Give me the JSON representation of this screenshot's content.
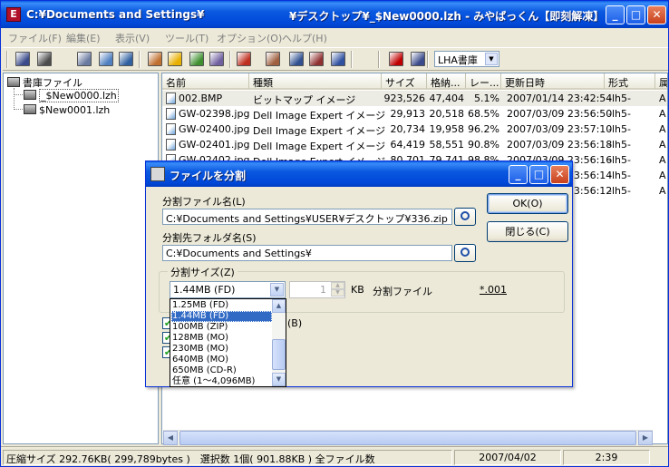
{
  "window": {
    "app_icon": "E",
    "title": "C:¥Documents and Settings¥",
    "title_right": "¥デスクトップ¥_$New0000.lzh - みやばっくん【即刻解凍】",
    "minimize": "_",
    "maximize": "□",
    "close": "✕"
  },
  "menu": [
    {
      "label": "ファイル(F)"
    },
    {
      "label": "編集(E)"
    },
    {
      "label": "表示(V)"
    },
    {
      "label": "ツール(T)"
    },
    {
      "label": "オプション(O)"
    },
    {
      "label": "ヘルプ(H)"
    }
  ],
  "toolbar": {
    "archive_type": "LHA書庫",
    "colors": [
      "#3a4a8a",
      "#4c4c4c",
      "#6a7aa0",
      "#5080c0",
      "#3060a0",
      "#c07030",
      "#e8b000",
      "#409030",
      "#7060a0",
      "#c03020",
      "#a06040",
      "#305090",
      "#903030",
      "#3050a0",
      "#c00000"
    ]
  },
  "tree": {
    "root": "書庫ファイル",
    "items": [
      "_$New0000.lzh",
      "$New0001.lzh"
    ]
  },
  "list": {
    "columns": [
      "名前",
      "種類",
      "サイズ",
      "格納...",
      "レー...",
      "更新日時",
      "形式",
      "属"
    ],
    "rows": [
      {
        "name": "002.BMP",
        "type": "ビットマップ イメージ",
        "size": "923,526",
        "packed": "47,404",
        "ratio": "5.1%",
        "date": "2007/01/14 23:42:54",
        "format": "-lh5-",
        "attr": "A"
      },
      {
        "name": "GW-02398.jpg",
        "type": "Dell Image Expert イメージ",
        "size": "29,913",
        "packed": "20,518",
        "ratio": "68.5%",
        "date": "2007/03/09 23:56:50",
        "format": "-lh5-",
        "attr": "A"
      },
      {
        "name": "GW-02400.jpg",
        "type": "Dell Image Expert イメージ",
        "size": "20,734",
        "packed": "19,958",
        "ratio": "96.2%",
        "date": "2007/03/09 23:57:10",
        "format": "-lh5-",
        "attr": "A"
      },
      {
        "name": "GW-02401.jpg",
        "type": "Dell Image Expert イメージ",
        "size": "64,419",
        "packed": "58,551",
        "ratio": "90.8%",
        "date": "2007/03/09 23:56:18",
        "format": "-lh5-",
        "attr": "A"
      },
      {
        "name": "GW-02402.jpg",
        "type": "Dell Image Expert イメージ",
        "size": "80,701",
        "packed": "79,741",
        "ratio": "98.8%",
        "date": "2007/03/09 23:56:16",
        "format": "-lh5-",
        "attr": "A"
      },
      {
        "name": "",
        "type": "",
        "size": "",
        "packed": "",
        "ratio": "",
        "date": "2007/03/09 23:56:14",
        "format": "-lh5-",
        "attr": "A"
      },
      {
        "name": "",
        "type": "",
        "size": "",
        "packed": "",
        "ratio": "",
        "date": "2007/03/09 23:56:12",
        "format": "-lh5-",
        "attr": "A"
      }
    ]
  },
  "status": {
    "summary": "圧縮サイズ 292.76KB( 299,789bytes )　選択数 1個( 901.88KB )  全ファイル数",
    "date": "2007/04/02",
    "time": "2:39"
  },
  "dialog": {
    "title": "ファイルを分割",
    "split_file_label": "分割ファイル名(L)",
    "split_file_value": "C:¥Documents and Settings¥USER¥デスクトップ¥336.zip",
    "dest_folder_label": "分割先フォルダ名(S)",
    "dest_folder_value": "C:¥Documents and Settings¥",
    "ok": "OK(O)",
    "close": "閉じる(C)",
    "size_group_label": "分割サイズ(Z)",
    "size_selected": "1.44MB (FD)",
    "spin_value": "1",
    "kb_label": "KB",
    "split_file_word": "分割ファイル",
    "extension": "*.001",
    "option_b_label": "(B)",
    "size_options": [
      "1.25MB (FD)",
      "1.44MB (FD)",
      "100MB (ZIP)",
      "128MB (MO)",
      "230MB (MO)",
      "640MB (MO)",
      "650MB (CD-R)",
      "任意 (1～4,096MB)"
    ]
  }
}
